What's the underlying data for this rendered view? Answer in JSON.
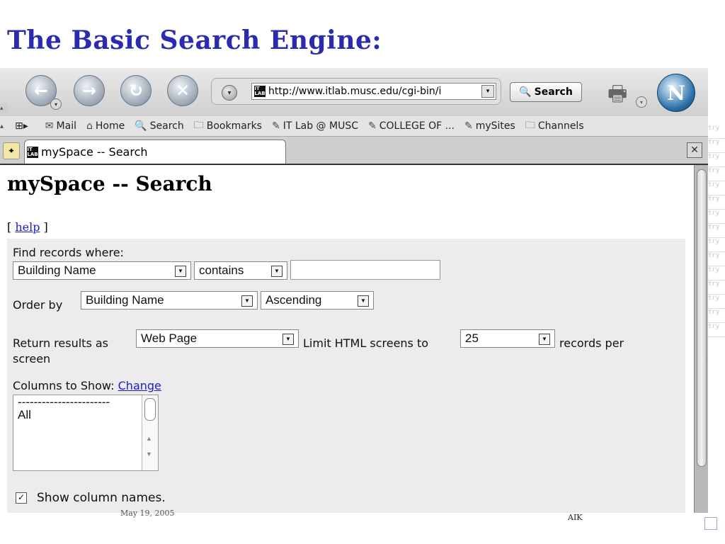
{
  "slide": {
    "title": "The Basic Search Engine:",
    "footer_author": "AIK",
    "footer_date": "May 19, 2005"
  },
  "browser": {
    "url": "http://www.itlab.musc.edu/cgi-bin/i",
    "site_icon_text": "IT\nLAB",
    "search_button": "Search",
    "logo_letter": "N",
    "bookmarks": [
      {
        "icon": "mail-icon",
        "glyph": "✉",
        "label": "Mail"
      },
      {
        "icon": "home-icon",
        "glyph": "⌂",
        "label": "Home"
      },
      {
        "icon": "search-icon",
        "glyph": "🔍",
        "label": "Search"
      },
      {
        "icon": "folder-icon",
        "glyph": "🗀",
        "label": "Bookmarks"
      },
      {
        "icon": "bookmark-icon",
        "glyph": "✎",
        "label": "IT Lab @ MUSC"
      },
      {
        "icon": "bookmark-icon",
        "glyph": "✎",
        "label": "COLLEGE OF ..."
      },
      {
        "icon": "bookmark-icon",
        "glyph": "✎",
        "label": "mySites"
      },
      {
        "icon": "folder-icon",
        "glyph": "🗀",
        "label": "Channels"
      }
    ],
    "tab_title": "mySpace -- Search",
    "bg_text": "try"
  },
  "page": {
    "heading": "mySpace -- Search",
    "help_open": "[ ",
    "help_link": "help",
    "help_close": " ]",
    "find_label": "Find records where:",
    "field_select": "Building Name",
    "operator_select": "contains",
    "search_value": "",
    "order_label": "Order by",
    "order_field": "Building Name",
    "order_direction": "Ascending",
    "return_label": "Return results as",
    "return_format": "Web Page",
    "limit_label": "Limit HTML screens to",
    "limit_value": "25",
    "records_label": "records per",
    "screen_label": "screen",
    "columns_label": "Columns to Show:",
    "change_link": "Change",
    "columns_options": [
      "-----------------------",
      "All"
    ],
    "show_names_checked": true,
    "show_names_label": "Show column names."
  },
  "colors": {
    "title": "#2b2bb0",
    "link": "#1a1ad0",
    "form_bg": "#ececec"
  }
}
